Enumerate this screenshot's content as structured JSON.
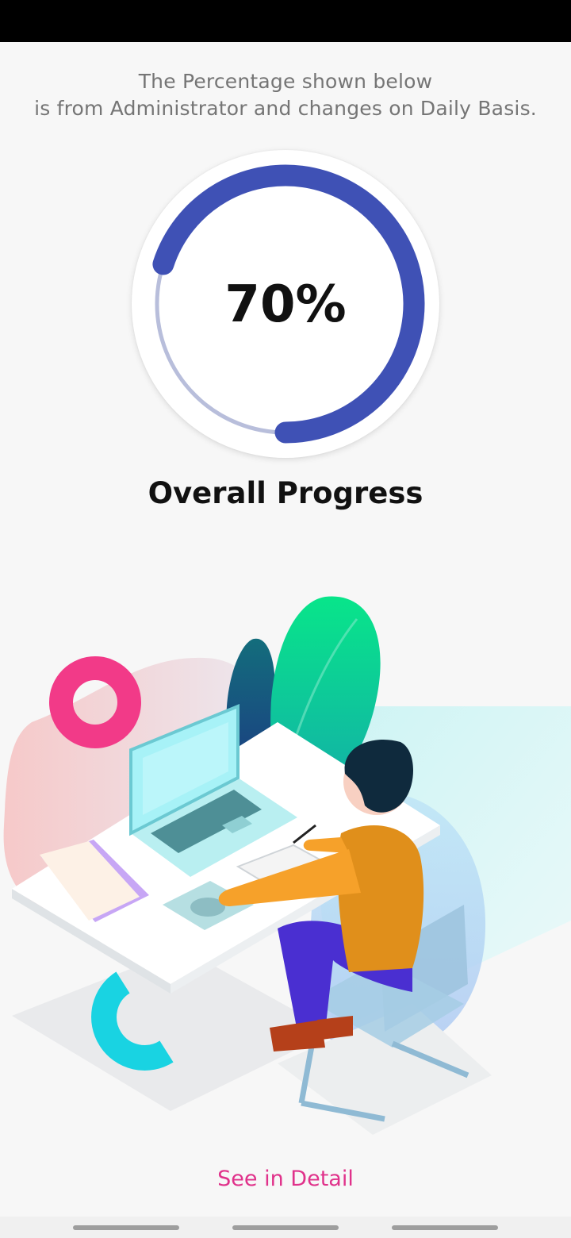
{
  "notice": {
    "line1": "The Percentage shown below",
    "line2": "is from Administrator and changes on Daily Basis."
  },
  "progress": {
    "value": 70,
    "display": "70%",
    "label": "Overall Progress",
    "colors": {
      "filled": "#3f51b5",
      "track": "#b8bedb",
      "background": "#ffffff"
    }
  },
  "illustration": {
    "name": "person-working-at-laptop-illustration"
  },
  "detail_link": {
    "label": "See in Detail",
    "color": "#e0328b"
  },
  "nav_bar": {
    "items": [
      "recent-apps",
      "home",
      "back"
    ]
  }
}
